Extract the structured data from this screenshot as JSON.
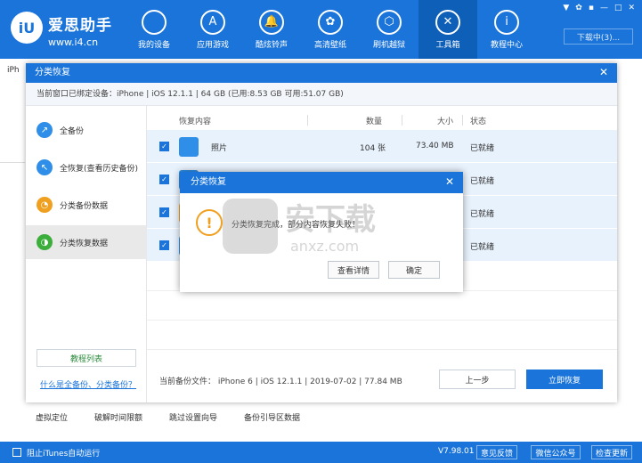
{
  "app": {
    "name": "爱思助手",
    "url": "www.i4.cn",
    "logo": "iU"
  },
  "nav": [
    {
      "label": "我的设备",
      "icon": ""
    },
    {
      "label": "应用游戏",
      "icon": "A"
    },
    {
      "label": "酷炫铃声",
      "icon": "🔔"
    },
    {
      "label": "高清壁纸",
      "icon": "✿"
    },
    {
      "label": "刷机越狱",
      "icon": "⬡"
    },
    {
      "label": "工具箱",
      "icon": "✕"
    },
    {
      "label": "教程中心",
      "icon": "i"
    }
  ],
  "window_controls": {
    "a": "▼",
    "b": "✿",
    "c": "▪",
    "min": "—",
    "max": "□",
    "close": "✕"
  },
  "download_button": "下载中(3)...",
  "background": {
    "tab": "iPh",
    "links": [
      "虚拟定位",
      "破解时间限额",
      "跳过设置向导",
      "备份引导区数据"
    ]
  },
  "statusbar": {
    "itunes_text": "阻止iTunes自动运行",
    "version": "V7.98.01",
    "feedback": "意见反馈",
    "wechat": "微信公众号",
    "update": "检查更新"
  },
  "dialog": {
    "title": "分类恢复",
    "close": "✕",
    "device_info": "当前窗口已绑定设备：iPhone  |  iOS 12.1.1  |  64 GB (已用:8.53 GB 可用:51.07 GB)",
    "sidebar": [
      {
        "label": "全备份",
        "color": "#2f8fe8",
        "icon": "↗"
      },
      {
        "label": "全恢复(查看历史备份)",
        "color": "#2f8fe8",
        "icon": "↖"
      },
      {
        "label": "分类备份数据",
        "color": "#f0a020",
        "icon": "◔"
      },
      {
        "label": "分类恢复数据",
        "color": "#3cae3c",
        "icon": "◑"
      }
    ],
    "tutorial_button": "教程列表",
    "help_link": "什么是全备份、分类备份？",
    "table_headers": {
      "content": "恢复内容",
      "count": "数量",
      "size": "大小",
      "status": "状态"
    },
    "rows": [
      {
        "name": "照片",
        "count": "104 张",
        "size": "73.40 MB",
        "status": "已就绪"
      },
      {
        "name": "",
        "count": "",
        "size": "",
        "status": "已就绪"
      },
      {
        "name": "",
        "count": "",
        "size": "",
        "status": "已就绪"
      },
      {
        "name": "",
        "count": "",
        "size": "",
        "status": "已就绪"
      }
    ],
    "checkmark": "✓",
    "footer_info": "当前备份文件：  iPhone 6 | iOS 12.1.1 | 2019-07-02 | 77.84 MB",
    "prev_button": "上一步",
    "restore_button": "立即恢复"
  },
  "popup": {
    "title": "分类恢复",
    "close": "✕",
    "icon": "!",
    "message": "分类恢复完成，部分内容恢复失败！",
    "detail_button": "查看详情",
    "ok_button": "确定"
  },
  "watermark": {
    "text": "安下载",
    "url": "anxz.com"
  }
}
